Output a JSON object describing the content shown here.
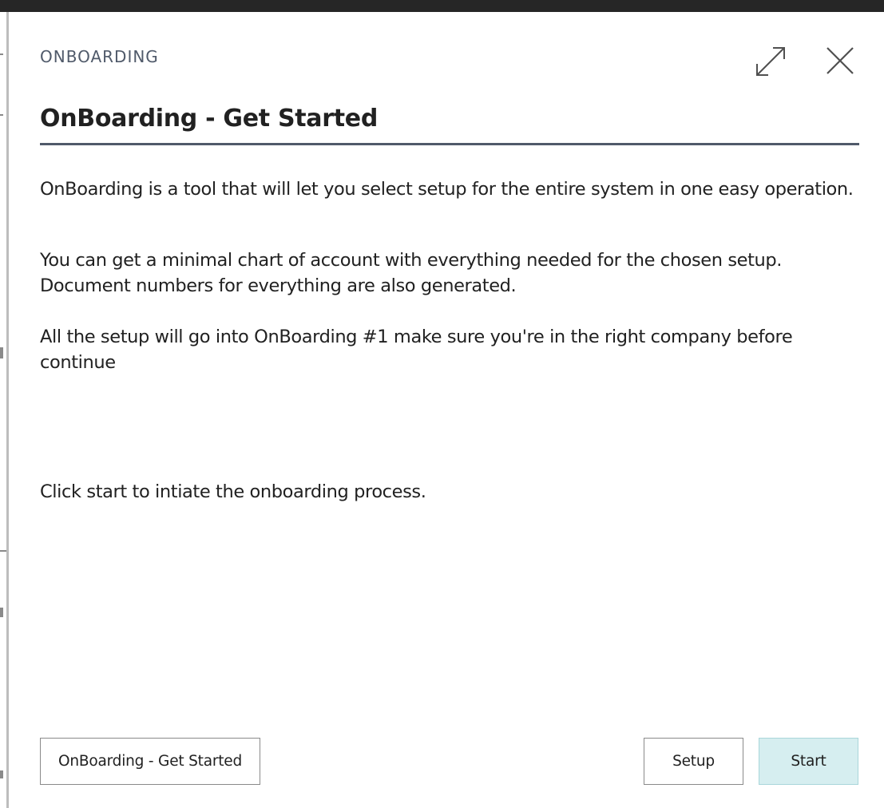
{
  "dialog": {
    "caption": "ONBOARDING",
    "title": "OnBoarding - Get Started",
    "paragraphs": [
      "OnBoarding is a tool that will let you select setup for the entire system in one easy operation.",
      "You can get a minimal chart of account with everything needed for the chosen setup. Document numbers for everything are also generated.",
      "All the setup will go into OnBoarding #1 make sure you're in the right company before continue",
      "Click start to intiate the onboarding process."
    ],
    "icons": {
      "expand": "expand-icon",
      "close": "close-icon"
    }
  },
  "buttons": {
    "get_started": "OnBoarding - Get Started",
    "setup": "Setup",
    "start": "Start"
  },
  "colors": {
    "accent": "#505a6a",
    "primary_button_bg": "#d6eef0",
    "top_bar": "#262626"
  }
}
